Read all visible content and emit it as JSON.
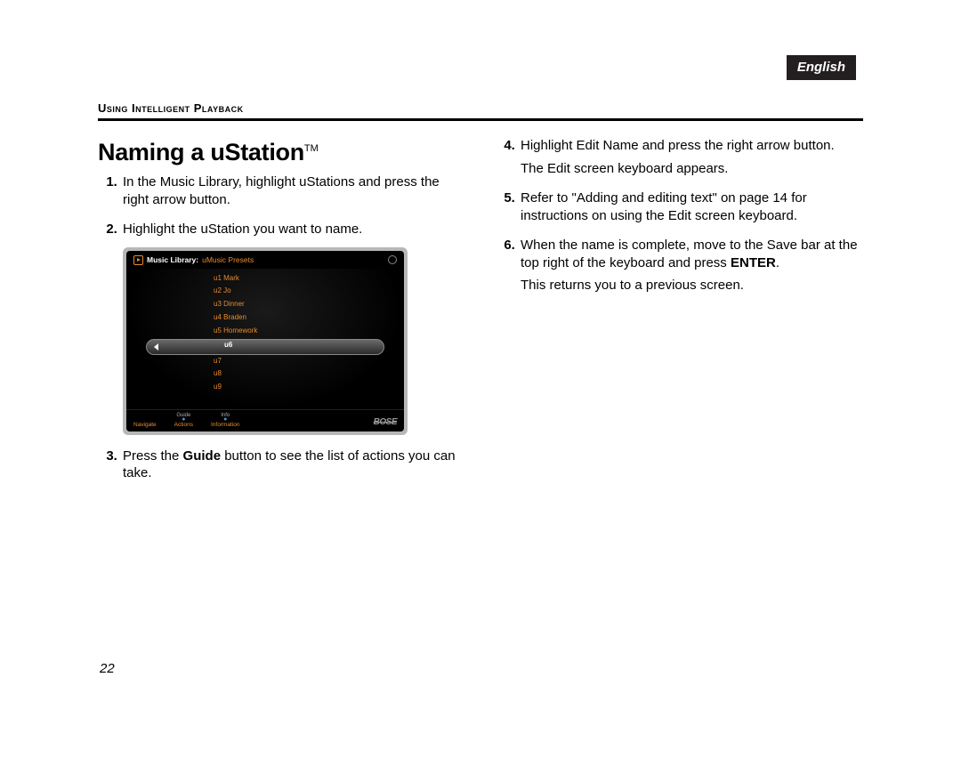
{
  "language_tab": "English",
  "section_header": "Using Intelligent Playback",
  "title_main": "Naming a uStation",
  "title_tm": "TM",
  "left_steps": {
    "s1": "In the Music Library, highlight uStations and press the right arrow button.",
    "s2": "Highlight the uStation you want to name.",
    "s3_pre": "Press the ",
    "s3_bold": "Guide",
    "s3_post": " button to see the list of actions you can take."
  },
  "right_steps": {
    "s4": "Highlight Edit Name and press the right arrow button.",
    "s4_sub": "The Edit screen keyboard appears.",
    "s5": "Refer to \"Adding and editing text\" on page 14 for instructions on using the Edit screen keyboard.",
    "s6_pre": "When the name is complete, move to the Save bar at the top right of the keyboard and press ",
    "s6_bold": "ENTER",
    "s6_post": ".",
    "s6_sub": "This returns you to a previous screen."
  },
  "screenshot": {
    "breadcrumb_lib": "Music Library:",
    "breadcrumb_sub": "uMusic Presets",
    "items": {
      "r1": "u1 Mark",
      "r2": "u2 Jo",
      "r3": "u3 Dinner",
      "r4": "u4 Braden",
      "r5": "u5 Homework",
      "r6": "u6",
      "r7": "u7",
      "r8": "u8",
      "r9": "u9"
    },
    "footer": {
      "navigate": "Navigate",
      "guide": "Guide",
      "actions": "Actions",
      "info": "Info",
      "information": "Information",
      "brand": "BOSE"
    }
  },
  "page_number": "22"
}
